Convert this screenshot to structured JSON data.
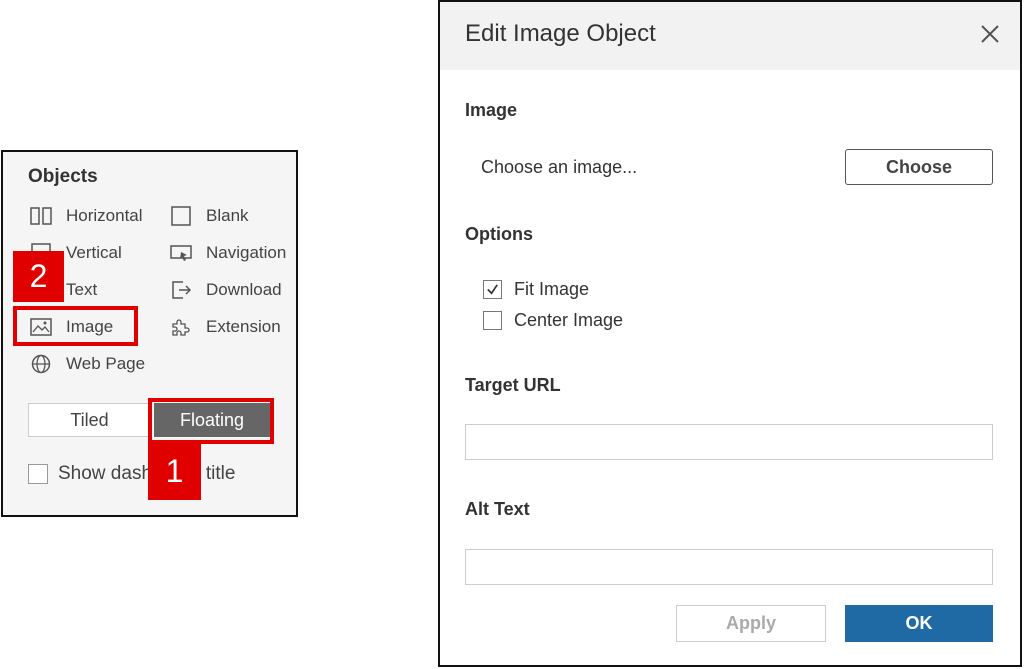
{
  "objects_panel": {
    "title": "Objects",
    "items": [
      {
        "label": "Horizontal",
        "icon": "horizontal-layout-icon"
      },
      {
        "label": "Blank",
        "icon": "blank-icon"
      },
      {
        "label": "Vertical",
        "icon": "vertical-layout-icon"
      },
      {
        "label": "Navigation",
        "icon": "navigation-icon"
      },
      {
        "label": "Text",
        "icon": "text-icon"
      },
      {
        "label": "Download",
        "icon": "download-icon"
      },
      {
        "label": "Image",
        "icon": "image-icon"
      },
      {
        "label": "Extension",
        "icon": "extension-icon"
      },
      {
        "label": "Web Page",
        "icon": "globe-icon"
      }
    ],
    "tiled_label": "Tiled",
    "floating_label": "Floating",
    "show_title_label": "Show dashboard title"
  },
  "callouts": {
    "one": "1",
    "two": "2",
    "color": "#e00000"
  },
  "dialog": {
    "title": "Edit Image Object",
    "image_section": "Image",
    "choose_text": "Choose an image...",
    "choose_button": "Choose",
    "options_section": "Options",
    "fit_image": "Fit Image",
    "fit_image_checked": true,
    "center_image": "Center Image",
    "center_image_checked": false,
    "target_url_section": "Target URL",
    "target_url_value": "",
    "alt_text_section": "Alt Text",
    "alt_text_value": "",
    "apply_button": "Apply",
    "ok_button": "OK",
    "ok_color": "#1f6aa5"
  }
}
